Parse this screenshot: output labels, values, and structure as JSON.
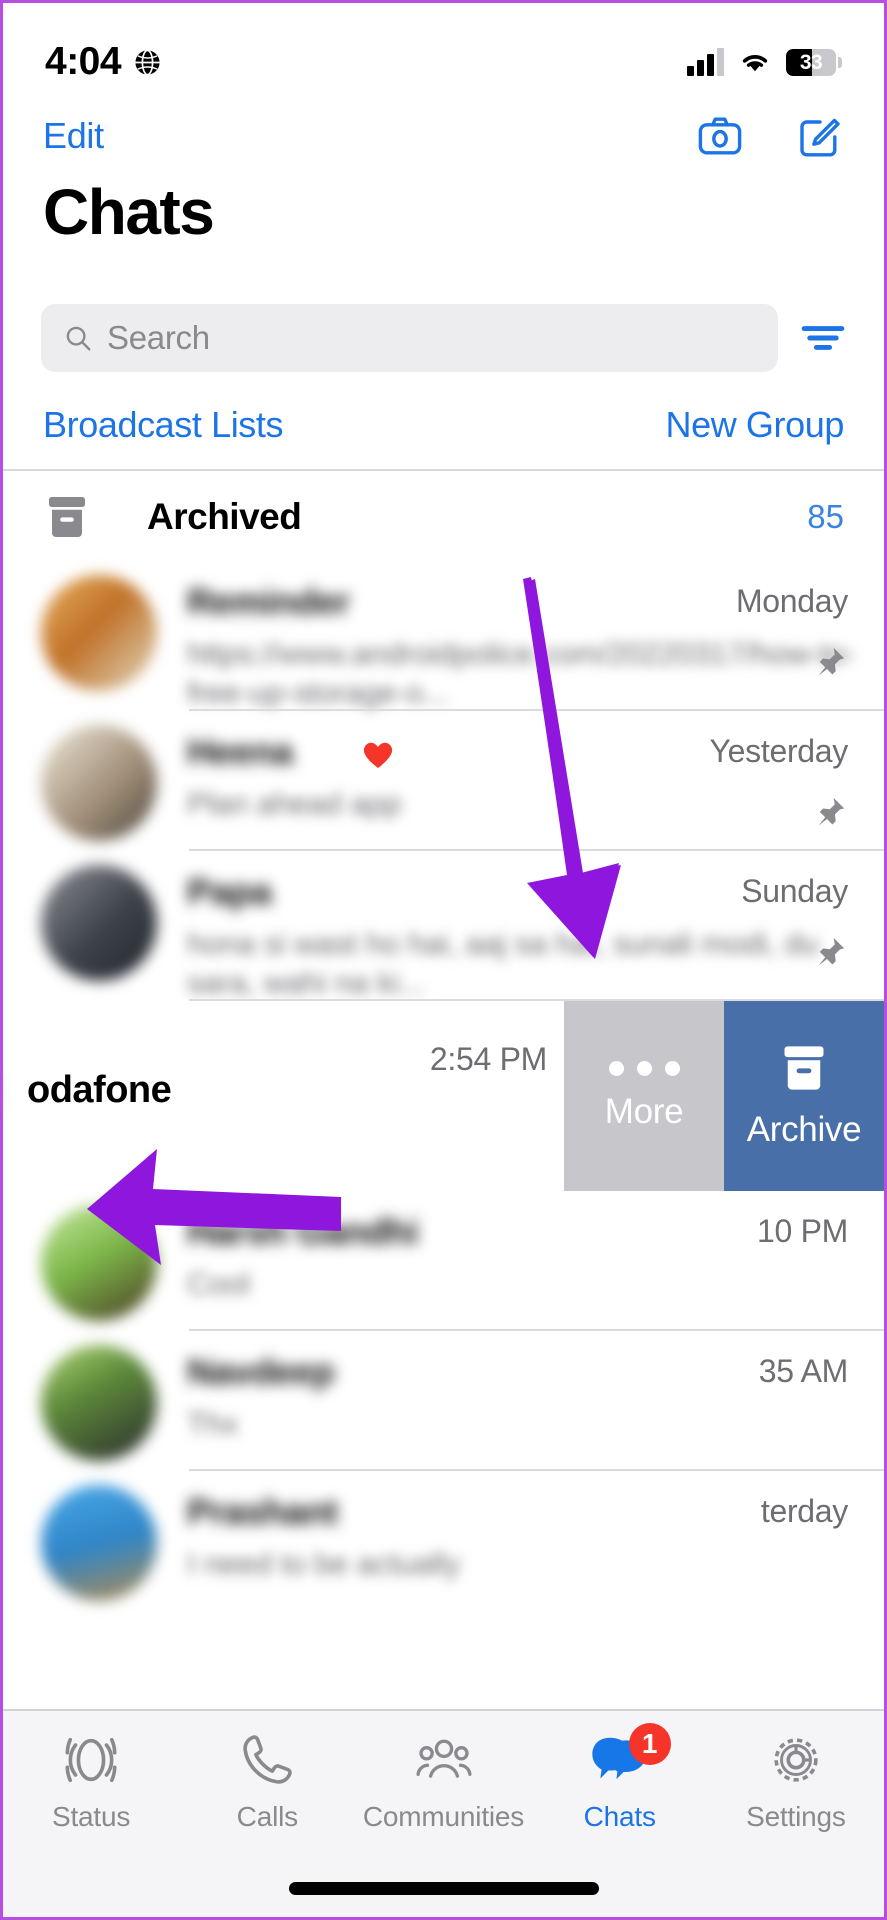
{
  "status_bar": {
    "time": "4:04",
    "location_icon": "globe-icon",
    "battery_percent": "33",
    "signal_icon": "cellular-bars-icon",
    "wifi_icon": "wifi-icon"
  },
  "nav": {
    "edit_label": "Edit",
    "camera_icon": "camera-icon",
    "compose_icon": "compose-icon"
  },
  "page_title": "Chats",
  "search": {
    "placeholder": "Search",
    "search_icon": "search-icon",
    "filter_icon": "filter-icon"
  },
  "quick_links": {
    "broadcast": "Broadcast Lists",
    "new_group": "New Group"
  },
  "archived": {
    "label": "Archived",
    "count": "85",
    "icon": "archive-box-icon"
  },
  "chats": [
    {
      "name": "Reminder",
      "message": "https://www.androidpolice.com/20220317/how-to-free-up-storage-o...",
      "time": "Monday",
      "pinned": true,
      "blurred": true,
      "avatar_color": "#d88a2a"
    },
    {
      "name": "Heena",
      "message": "Plan ahead app",
      "time": "Yesterday",
      "pinned": true,
      "blurred": true,
      "emoji": "❤️",
      "avatar_color": "#b8a890"
    },
    {
      "name": "Papa",
      "message": "hona si wast ho hai, aaj sa hai, sunali modi, du sara, wahi na ki...",
      "time": "Sunday",
      "pinned": true,
      "blurred": true,
      "avatar_color": "#5a5f6a"
    },
    {
      "name": "Harsh Gandhi",
      "message": "Cool",
      "time": "10 PM",
      "pinned": false,
      "blurred": true,
      "avatar_color": "#9cc46a"
    },
    {
      "name": "Navdeep",
      "message": "Thx",
      "time": "35 AM",
      "pinned": false,
      "blurred": true,
      "avatar_color": "#7fa848"
    },
    {
      "name": "Prashant",
      "message": "I need to be actually",
      "time": "terday",
      "pinned": false,
      "blurred": true,
      "avatar_color": "#3a9be0"
    }
  ],
  "swiped_chat": {
    "name": "odafone",
    "message": "",
    "time": "2:54 PM",
    "actions": {
      "more_label": "More",
      "more_icon": "ellipsis-icon",
      "more_color": "#c6c6cb",
      "archive_label": "Archive",
      "archive_icon": "archive-box-icon",
      "archive_color": "#486fa8"
    }
  },
  "tab_bar": {
    "items": [
      {
        "label": "Status",
        "icon": "status-rings-icon",
        "active": false,
        "badge": ""
      },
      {
        "label": "Calls",
        "icon": "phone-icon",
        "active": false,
        "badge": ""
      },
      {
        "label": "Communities",
        "icon": "communities-icon",
        "active": false,
        "badge": ""
      },
      {
        "label": "Chats",
        "icon": "chat-bubbles-icon",
        "active": true,
        "badge": "1"
      },
      {
        "label": "Settings",
        "icon": "gear-icon",
        "active": false,
        "badge": ""
      }
    ]
  },
  "annotations": {
    "arrow_color": "#8e16dd",
    "arrow_down_target": "swipe actions on chat row",
    "arrow_left_target": "swiped chat row"
  },
  "colors": {
    "accent_blue": "#1c74e6",
    "archive_blue": "#486fa8",
    "more_gray": "#c6c6cb",
    "badge_red": "#f5342a",
    "annotation_purple": "#8e16dd"
  }
}
